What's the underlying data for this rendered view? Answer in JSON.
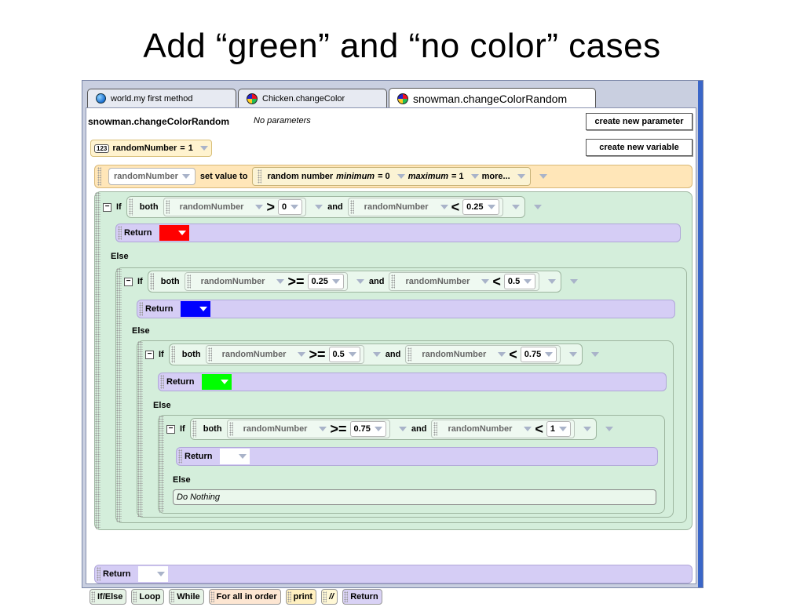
{
  "slide": {
    "title": "Add “green” and “no color” cases"
  },
  "tabs": [
    {
      "label": "world.my first method",
      "icon": "globe-icon"
    },
    {
      "label": "Chicken.changeColor",
      "icon": "color-wheel-icon"
    },
    {
      "label": "snowman.changeColorRandom",
      "icon": "color-wheel-icon"
    }
  ],
  "method": {
    "name": "snowman.changeColorRandom",
    "params": "No parameters"
  },
  "buttons": {
    "new_param": "create new parameter",
    "new_var": "create new variable"
  },
  "variable": {
    "type_icon": "123",
    "name": "randomNumber",
    "eq": "=",
    "value": "1"
  },
  "set_stmt": {
    "var": "randomNumber",
    "action": "set value to",
    "func": "random number",
    "min_label": "minimum",
    "min_val": "= 0",
    "max_label": "maximum",
    "max_val": "= 1",
    "more": "more..."
  },
  "kw": {
    "if": "If",
    "both": "both",
    "and": "and",
    "return": "Return",
    "else": "Else",
    "do_nothing": "Do Nothing"
  },
  "conds": [
    {
      "left": "randomNumber",
      "op1": ">",
      "v1": "0",
      "op2": "<",
      "v2": "0.25",
      "ret_color": "#ff0000"
    },
    {
      "left": "randomNumber",
      "op1": ">=",
      "v1": "0.25",
      "op2": "<",
      "v2": "0.5",
      "ret_color": "#0000ff"
    },
    {
      "left": "randomNumber",
      "op1": ">=",
      "v1": "0.5",
      "op2": "<",
      "v2": "0.75",
      "ret_color": "#00ff00"
    },
    {
      "left": "randomNumber",
      "op1": ">=",
      "v1": "0.75",
      "op2": "<",
      "v2": "1",
      "ret_color": "#ffffff"
    }
  ],
  "palette": [
    "If/Else",
    "Loop",
    "While",
    "For all in order",
    "print",
    "//",
    "Return"
  ]
}
